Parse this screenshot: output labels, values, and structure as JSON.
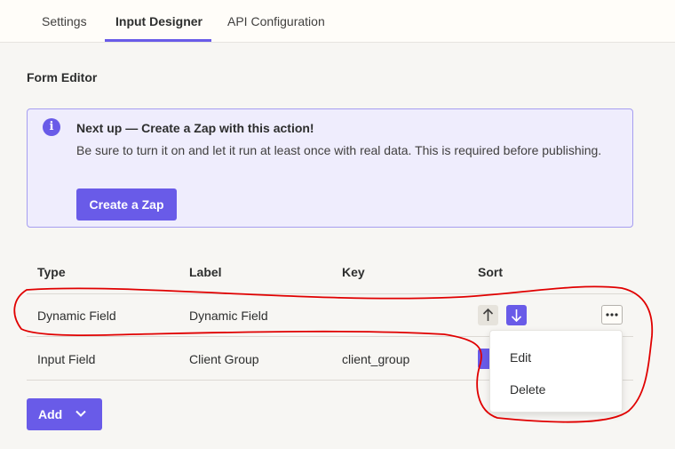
{
  "tabs": [
    {
      "label": "Settings"
    },
    {
      "label": "Input Designer",
      "active": true
    },
    {
      "label": "API Configuration"
    }
  ],
  "form_editor": {
    "title": "Form Editor"
  },
  "banner": {
    "icon": "info-icon",
    "title": "Next up — Create a Zap with this action!",
    "text": "Be sure to turn it on and let it run at least once with real data. This is required before publishing.",
    "button_label": "Create a Zap"
  },
  "table": {
    "headers": [
      "Type",
      "Label",
      "Key",
      "Sort"
    ],
    "rows": [
      {
        "type": "Dynamic Field",
        "label": "Dynamic Field",
        "key": ""
      },
      {
        "type": "Input Field",
        "label": "Client Group",
        "key": "client_group"
      }
    ]
  },
  "row_menu": {
    "items": [
      "Edit",
      "Delete"
    ]
  },
  "add_button": {
    "label": "Add"
  },
  "colors": {
    "accent": "#695be8",
    "annotation": "#e00000"
  }
}
